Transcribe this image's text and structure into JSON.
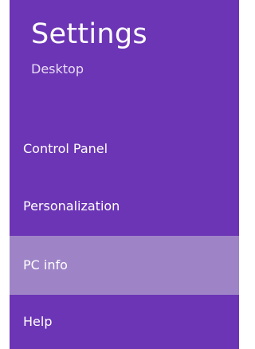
{
  "settings": {
    "title": "Settings",
    "subtitle": "Desktop",
    "items": [
      {
        "label": "Control Panel",
        "selected": false
      },
      {
        "label": "Personalization",
        "selected": false
      },
      {
        "label": "PC info",
        "selected": true
      },
      {
        "label": "Help",
        "selected": false
      }
    ]
  },
  "colors": {
    "panel_background": "#6c35b5",
    "selected_background": "#9e84c7",
    "text": "#ffffff"
  }
}
